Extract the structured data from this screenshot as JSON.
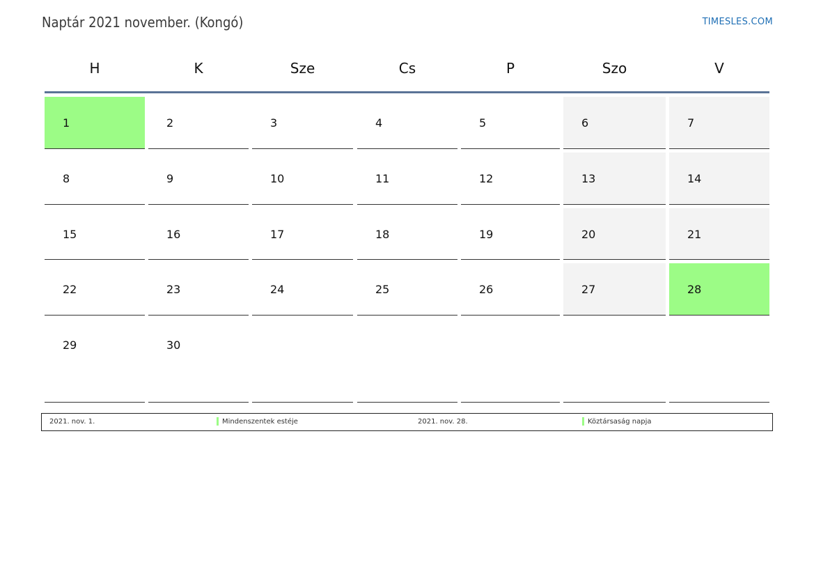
{
  "title": "Naptár 2021 november. (Kongó)",
  "brand": "TIMESLES.COM",
  "weekdays": [
    "H",
    "K",
    "Sze",
    "Cs",
    "P",
    "Szo",
    "V"
  ],
  "colors": {
    "holiday": "#9cfc86",
    "weekend": "#f3f3f3",
    "header_rule": "#5a7396",
    "brand": "#1f6fb5"
  },
  "weeks": [
    [
      {
        "day": "1",
        "type": "holiday"
      },
      {
        "day": "2",
        "type": "normal"
      },
      {
        "day": "3",
        "type": "normal"
      },
      {
        "day": "4",
        "type": "normal"
      },
      {
        "day": "5",
        "type": "normal"
      },
      {
        "day": "6",
        "type": "weekend"
      },
      {
        "day": "7",
        "type": "weekend"
      }
    ],
    [
      {
        "day": "8",
        "type": "normal"
      },
      {
        "day": "9",
        "type": "normal"
      },
      {
        "day": "10",
        "type": "normal"
      },
      {
        "day": "11",
        "type": "normal"
      },
      {
        "day": "12",
        "type": "normal"
      },
      {
        "day": "13",
        "type": "weekend"
      },
      {
        "day": "14",
        "type": "weekend"
      }
    ],
    [
      {
        "day": "15",
        "type": "normal"
      },
      {
        "day": "16",
        "type": "normal"
      },
      {
        "day": "17",
        "type": "normal"
      },
      {
        "day": "18",
        "type": "normal"
      },
      {
        "day": "19",
        "type": "normal"
      },
      {
        "day": "20",
        "type": "weekend"
      },
      {
        "day": "21",
        "type": "weekend"
      }
    ],
    [
      {
        "day": "22",
        "type": "normal"
      },
      {
        "day": "23",
        "type": "normal"
      },
      {
        "day": "24",
        "type": "normal"
      },
      {
        "day": "25",
        "type": "normal"
      },
      {
        "day": "26",
        "type": "normal"
      },
      {
        "day": "27",
        "type": "weekend"
      },
      {
        "day": "28",
        "type": "holiday"
      }
    ],
    [
      {
        "day": "29",
        "type": "normal"
      },
      {
        "day": "30",
        "type": "normal"
      },
      {
        "day": "",
        "type": "empty"
      },
      {
        "day": "",
        "type": "empty"
      },
      {
        "day": "",
        "type": "empty"
      },
      {
        "day": "",
        "type": "empty"
      },
      {
        "day": "",
        "type": "empty"
      }
    ]
  ],
  "holidays": [
    {
      "date": "2021. nov. 1.",
      "name": "Mindenszentek estéje"
    },
    {
      "date": "2021. nov. 28.",
      "name": "Köztársaság napja"
    }
  ]
}
